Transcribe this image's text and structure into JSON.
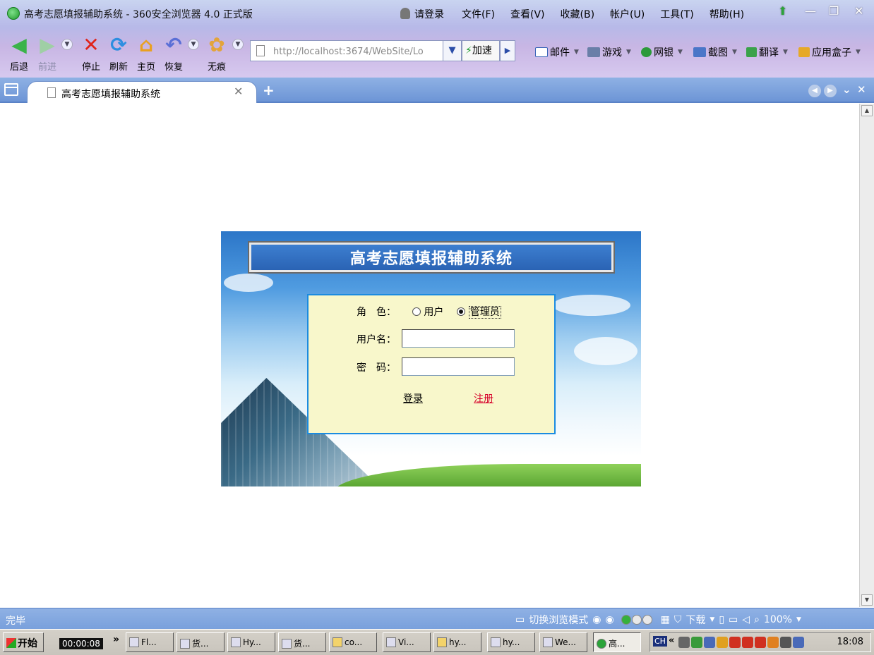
{
  "window": {
    "title": "高考志愿填报辅助系统 - 360安全浏览器 4.0 正式版",
    "login_text": "请登录",
    "menu": [
      "文件(F)",
      "查看(V)",
      "收藏(B)",
      "帐户(U)",
      "工具(T)",
      "帮助(H)"
    ],
    "controls": {
      "minimize": "—",
      "restore": "❐",
      "close": "✕"
    }
  },
  "toolbar": {
    "back": "后退",
    "forward": "前进",
    "stop": "停止",
    "refresh": "刷新",
    "home": "主页",
    "restore": "恢复",
    "incognito": "无痕",
    "address_value": "http://localhost:3674/WebSite/Lo",
    "speed_label": "加速",
    "quick_links": [
      "邮件",
      "游戏",
      "网银",
      "截图",
      "翻译",
      "应用盒子"
    ]
  },
  "tabs": {
    "active_tab_label": "高考志愿填报辅助系统",
    "close_glyph": "✕",
    "new_tab_glyph": "+"
  },
  "page": {
    "banner_title": "高考志愿填报辅助系统",
    "role_label": "角　色：",
    "role_options": [
      "用户",
      "管理员"
    ],
    "role_selected": "管理员",
    "username_label": "用户名：",
    "username_value": "",
    "password_label": "密　码：",
    "password_value": "",
    "login_button": "登录",
    "register_button": "注册"
  },
  "statusbar": {
    "status": "完毕",
    "switch_mode": "切换浏览模式",
    "download": "下载",
    "zoom": "100%"
  },
  "taskbar": {
    "start": "开始",
    "timer": "00:00:08",
    "overflow": "»",
    "items": [
      "Fl...",
      "货...",
      "Hy...",
      "货...",
      "co...",
      "Vi...",
      "hy...",
      "hy...",
      "We...",
      "高..."
    ],
    "clock": "18:08",
    "tray_prefix": "CH"
  },
  "colors": {
    "form_bg": "#f8f7cb",
    "form_border": "#1b8be0",
    "register_link": "#d6002a",
    "chrome_blue": "#8fb1e4"
  }
}
